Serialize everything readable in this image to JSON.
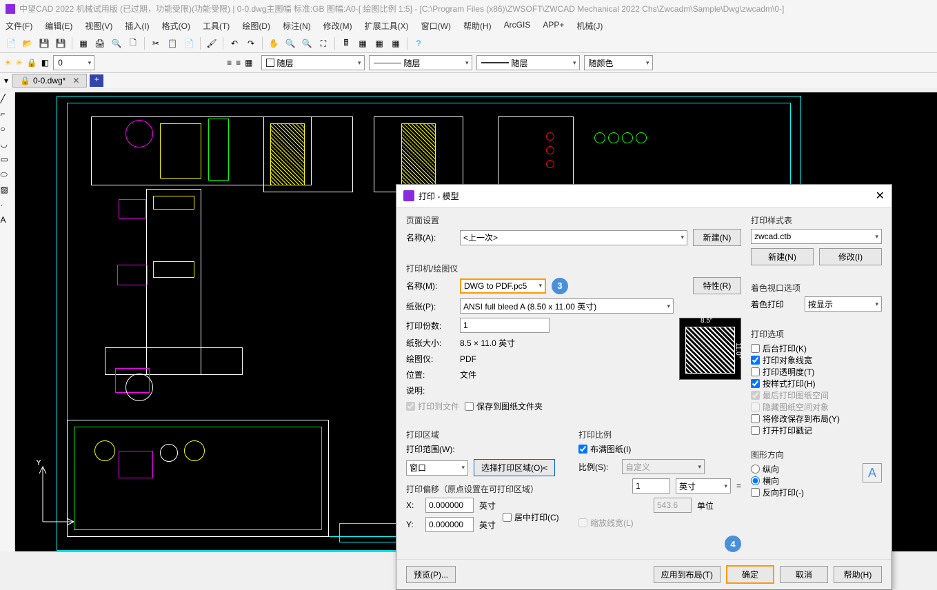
{
  "titlebar": "中望CAD 2022 机械试用版 (已过期，功能受限)(功能受限) | 0-0.dwg主图幅  标准:GB 图幅:A0-[ 绘图比例 1:5] - [C:\\Program Files (x86)\\ZWSOFT\\ZWCAD Mechanical 2022 Chs\\Zwcadm\\Sample\\Dwg\\zwcadm\\0-]",
  "menu": {
    "file": "文件(F)",
    "edit": "编辑(E)",
    "view": "视图(V)",
    "insert": "插入(I)",
    "format": "格式(O)",
    "tools": "工具(T)",
    "draw": "绘图(D)",
    "dimension": "标注(N)",
    "modify": "修改(M)",
    "extend": "扩展工具(X)",
    "window": "窗口(W)",
    "help": "帮助(H)",
    "arcgis": "ArcGIS",
    "appplus": "APP+",
    "mech": "机械(J)"
  },
  "props": {
    "layer1": "随层",
    "layer2": "随层",
    "layer3": "随层",
    "color": "随颜色"
  },
  "tab": {
    "name": "0-0.dwg*"
  },
  "dialog": {
    "title": "打印 - 模型",
    "page_setup": "页面设置",
    "name_label": "名称(A):",
    "name_value": "<上一次>",
    "new_btn": "新建(N)",
    "printer_section": "打印机/绘图仪",
    "printer_name_label": "名称(M):",
    "printer_name_value": "DWG to PDF.pc5",
    "props_btn": "特性(R)",
    "paper_label": "纸张(P):",
    "paper_value": "ANSI full bleed A (8.50 x 11.00 英寸)",
    "copies_label": "打印份数:",
    "copies_value": "1",
    "paper_size_label": "纸张大小:",
    "paper_size_value": "8.5 × 11.0  英寸",
    "plotter_label": "绘图仪:",
    "plotter_value": "PDF",
    "location_label": "位置:",
    "location_value": "文件",
    "desc_label": "说明:",
    "print_to_file": "打印到文件",
    "save_to_folder": "保存到图纸文件夹",
    "print_area": "打印区域",
    "print_range_label": "打印范围(W):",
    "print_range_value": "窗口",
    "select_area_btn": "选择打印区域(O)<",
    "offset_section": "打印偏移（原点设置在可打印区域）",
    "x_label": "X:",
    "x_value": "0.000000",
    "x_unit": "英寸",
    "y_label": "Y:",
    "y_value": "0.000000",
    "y_unit": "英寸",
    "center_print": "居中打印(C)",
    "scale_section": "打印比例",
    "fit_to_paper": "布满图纸(I)",
    "scale_label": "比例(S):",
    "scale_value": "自定义",
    "scale_num": "1",
    "scale_unit": "英寸",
    "scale_eq": "=",
    "scale_denom": "543.6",
    "scale_denom_unit": "单位",
    "scale_lineweights": "缩放线宽(L)",
    "style_section": "打印样式表",
    "style_value": "zwcad.ctb",
    "style_new": "新建(N)",
    "style_modify": "修改(I)",
    "shade_section": "着色视口选项",
    "shade_label": "着色打印",
    "shade_value": "按显示",
    "options_section": "打印选项",
    "opt_background": "后台打印(K)",
    "opt_lineweights": "打印对象线宽",
    "opt_transparency": "打印透明度(T)",
    "opt_style": "按样式打印(H)",
    "opt_paperspace": "最后打印图纸空间",
    "opt_hide": "隐藏图纸空间对象",
    "opt_save_layout": "将修改保存到布局(Y)",
    "opt_stamp": "打开打印戳记",
    "orient_section": "图形方向",
    "orient_portrait": "纵向",
    "orient_landscape": "横向",
    "orient_reverse": "反向打印(-)",
    "preview_btn": "预览(P)...",
    "apply_btn": "应用到布局(T)",
    "ok_btn": "确定",
    "cancel_btn": "取消",
    "help_btn": "帮助(H)",
    "paper_dim_w": "8.5″",
    "paper_dim_h": "11.0″",
    "callout3": "3",
    "callout4": "4"
  }
}
